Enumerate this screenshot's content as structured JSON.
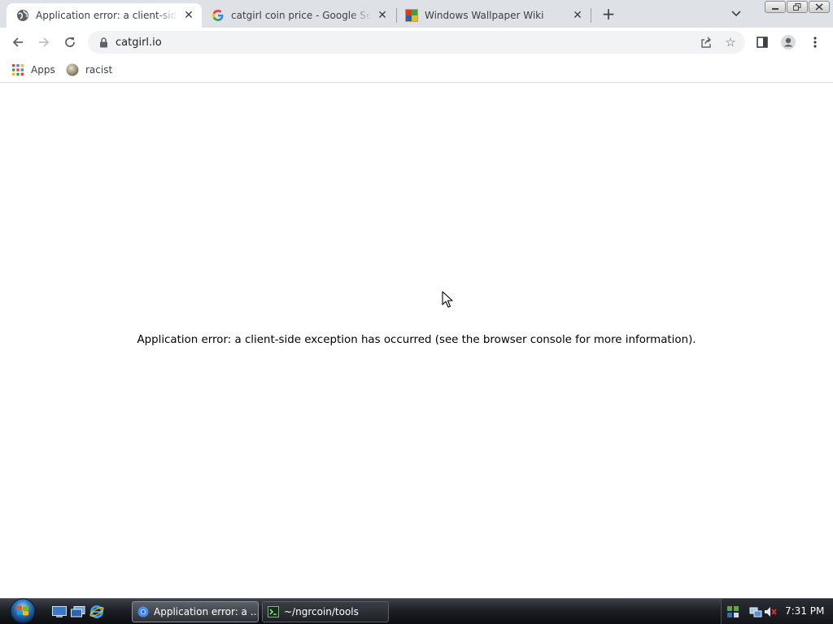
{
  "browser": {
    "tabs": [
      {
        "title": "Application error: a client-side exception has occurred",
        "active": true,
        "favicon": "globe-icon"
      },
      {
        "title": "catgirl coin price - Google Search",
        "active": false,
        "favicon": "google-g-icon"
      },
      {
        "title": "Windows Wallpaper Wiki",
        "active": false,
        "favicon": "wiki-favicon-icon"
      }
    ],
    "new_tab_symbol": "+",
    "close_symbol": "✕",
    "address": {
      "url": "catgirl.io",
      "lock_icon": "lock-icon"
    },
    "bookmarks": [
      {
        "label": "Apps",
        "icon": "apps-grid-icon"
      },
      {
        "label": "racist",
        "icon": "bookmark-favicon-icon"
      }
    ]
  },
  "page": {
    "error_message": "Application error: a client-side exception has occurred (see the browser console for more information)."
  },
  "taskbar": {
    "buttons": [
      {
        "label": "Application error: a ...",
        "icon": "chrome-icon",
        "active": true
      },
      {
        "label": "~/ngrcoin/tools",
        "icon": "terminal-icon",
        "active": false
      }
    ],
    "clock": "7:31 PM"
  },
  "colors": {
    "tabstrip_bg": "#dee1e6",
    "omnibox_bg": "#f1f3f4",
    "taskbar_bg": "#1d2025"
  }
}
